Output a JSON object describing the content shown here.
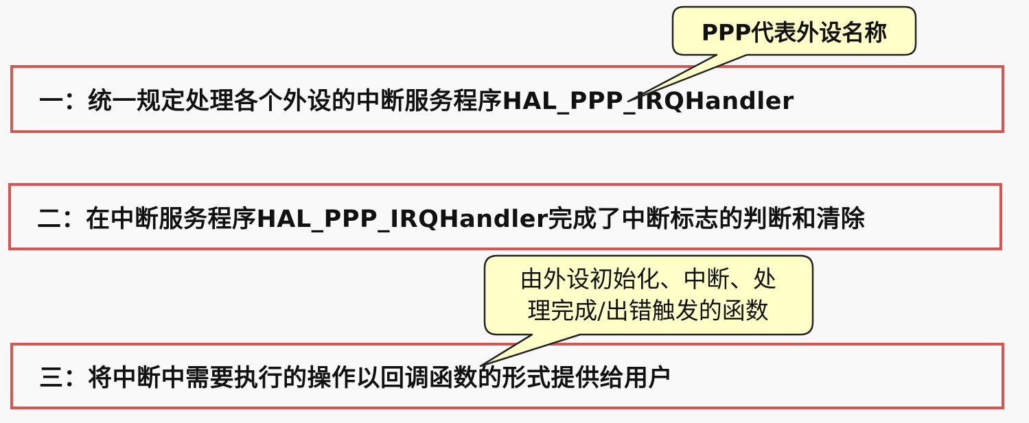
{
  "items": [
    {
      "text": "一：统一规定处理各个外设的中断服务程序HAL_PPP_IRQHandler"
    },
    {
      "text": "二：在中断服务程序HAL_PPP_IRQHandler完成了中断标志的判断和清除"
    },
    {
      "text": "三：将中断中需要执行的操作以回调函数的形式提供给用户"
    }
  ],
  "callouts": [
    {
      "lines": [
        "PPP代表外设名称"
      ]
    },
    {
      "lines": [
        "由外设初始化、中断、处",
        "理完成/出错触发的函数"
      ]
    }
  ],
  "colors": {
    "box_border": "#d9534f",
    "callout_fill": "#ffffc8",
    "callout_stroke": "#222222"
  }
}
